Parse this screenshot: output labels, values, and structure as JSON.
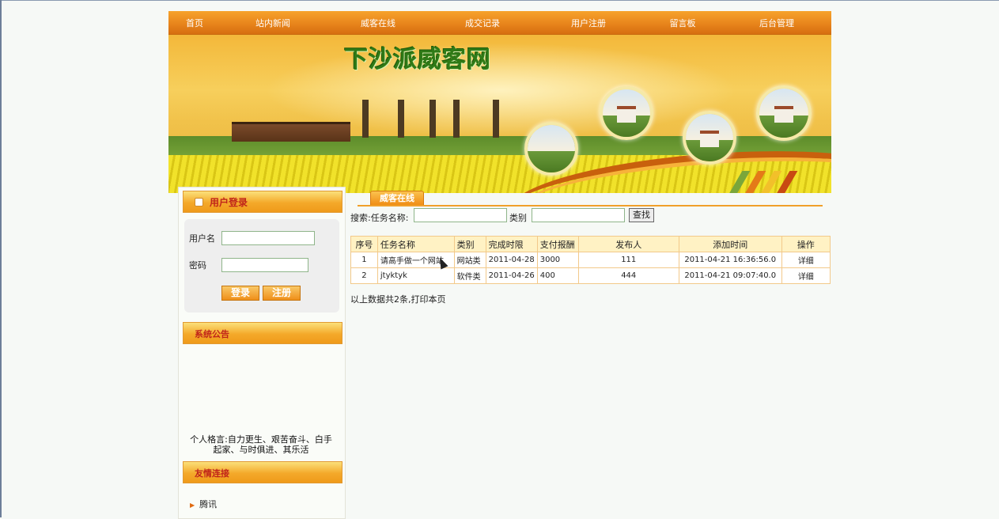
{
  "nav": {
    "items": [
      "首页",
      "站内新闻",
      "威客在线",
      "成交记录",
      "用户注册",
      "留言板",
      "后台管理"
    ]
  },
  "banner": {
    "title": "下沙派威客网"
  },
  "login": {
    "header": "用户登录",
    "username_label": "用户名",
    "password_label": "密码",
    "username_value": "",
    "password_value": "",
    "login_button": "登录",
    "register_button": "注册"
  },
  "announcement": {
    "header": "系统公告",
    "motto": "个人格言:自力更生、艰苦奋斗、白手起家、与时俱进、其乐活"
  },
  "friend_links": {
    "header": "友情连接",
    "items": [
      "腾讯"
    ]
  },
  "main": {
    "tab_label": "威客在线",
    "search": {
      "prefix": "搜索:任务名称:",
      "task_value": "",
      "category_label": "类别",
      "category_value": "",
      "button": "查找"
    },
    "table": {
      "columns": [
        "序号",
        "任务名称",
        "类别",
        "完成时限",
        "支付报酬",
        "发布人",
        "添加时间",
        "操作"
      ],
      "rows": [
        [
          "1",
          "请高手做一个网站",
          "网站类",
          "2011-04-28",
          "3000",
          "111",
          "2011-04-21 16:36:56.0",
          "详细"
        ],
        [
          "2",
          "jtyktyk",
          "软件类",
          "2011-04-26",
          "400",
          "444",
          "2011-04-21 09:07:40.0",
          "详细"
        ]
      ]
    },
    "footer": "以上数据共2条,打印本页"
  },
  "colors": {
    "nav_orange": "#e6821a",
    "header_red": "#c0241a",
    "table_border": "#f2c98a",
    "title_green": "#2f7a16"
  }
}
